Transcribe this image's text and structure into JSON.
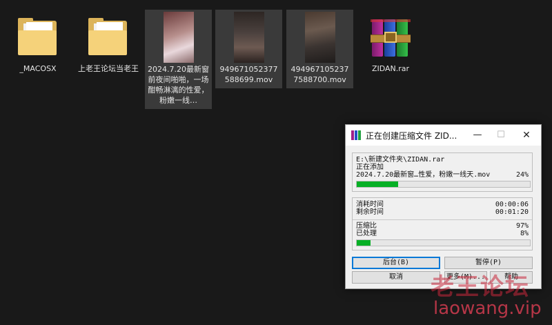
{
  "files": [
    {
      "name": "_MACOSX",
      "kind": "folder"
    },
    {
      "name": "上老王论坛当老王",
      "kind": "folder"
    },
    {
      "name": "2024.7.20最新窗前夜间啪啪，一场酣畅淋漓的性爱，粉嫩一线…",
      "kind": "video"
    },
    {
      "name": "949671052377588699.mov",
      "kind": "video"
    },
    {
      "name": "4949671052377588700.mov",
      "kind": "video"
    },
    {
      "name": "ZIDAN.rar",
      "kind": "archive"
    }
  ],
  "dialog": {
    "title": "正在创建压缩文件 ZID...",
    "path": "E:\\新建文件夹\\ZIDAN.rar",
    "status": "正在添加",
    "current_file": "2024.7.20最新窗…性爱，粉嫩一线天.mov",
    "current_percent": "24%",
    "current_progress": 0.24,
    "elapsed_label": "消耗时间",
    "elapsed_value": "00:00:06",
    "remaining_label": "剩余时间",
    "remaining_value": "00:01:20",
    "ratio_label": "压缩比",
    "ratio_value": "97%",
    "processed_label": "已处理",
    "processed_value": "8%",
    "total_progress": 0.08,
    "buttons": {
      "background": "后台(B)",
      "pause": "暂停(P)",
      "cancel": "取消",
      "more": "更多(M)...",
      "help": "帮助"
    }
  },
  "watermark": {
    "line1": "老王论坛",
    "line2": "laowang.vip"
  },
  "colors": {
    "progress": "#06b025",
    "desktop": "#191919",
    "watermark": "#c8283c"
  }
}
